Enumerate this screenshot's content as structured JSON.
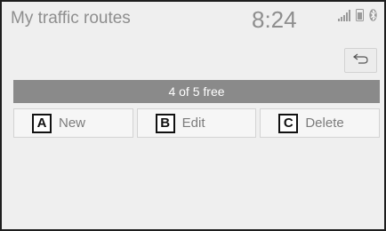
{
  "header": {
    "title": "My traffic routes",
    "clock": "8:24",
    "icons": [
      "signal-icon",
      "phone-battery-icon",
      "bluetooth-icon"
    ]
  },
  "toolbar": {
    "back_icon": "back-arrow-icon"
  },
  "status": {
    "free_text": "4 of 5 free"
  },
  "actions": [
    {
      "letter": "A",
      "label": "New"
    },
    {
      "letter": "B",
      "label": "Edit"
    },
    {
      "letter": "C",
      "label": "Delete"
    }
  ],
  "colors": {
    "background": "#efefef",
    "free_bar": "#8a8a8a",
    "text_gray": "#8e8e8e"
  }
}
